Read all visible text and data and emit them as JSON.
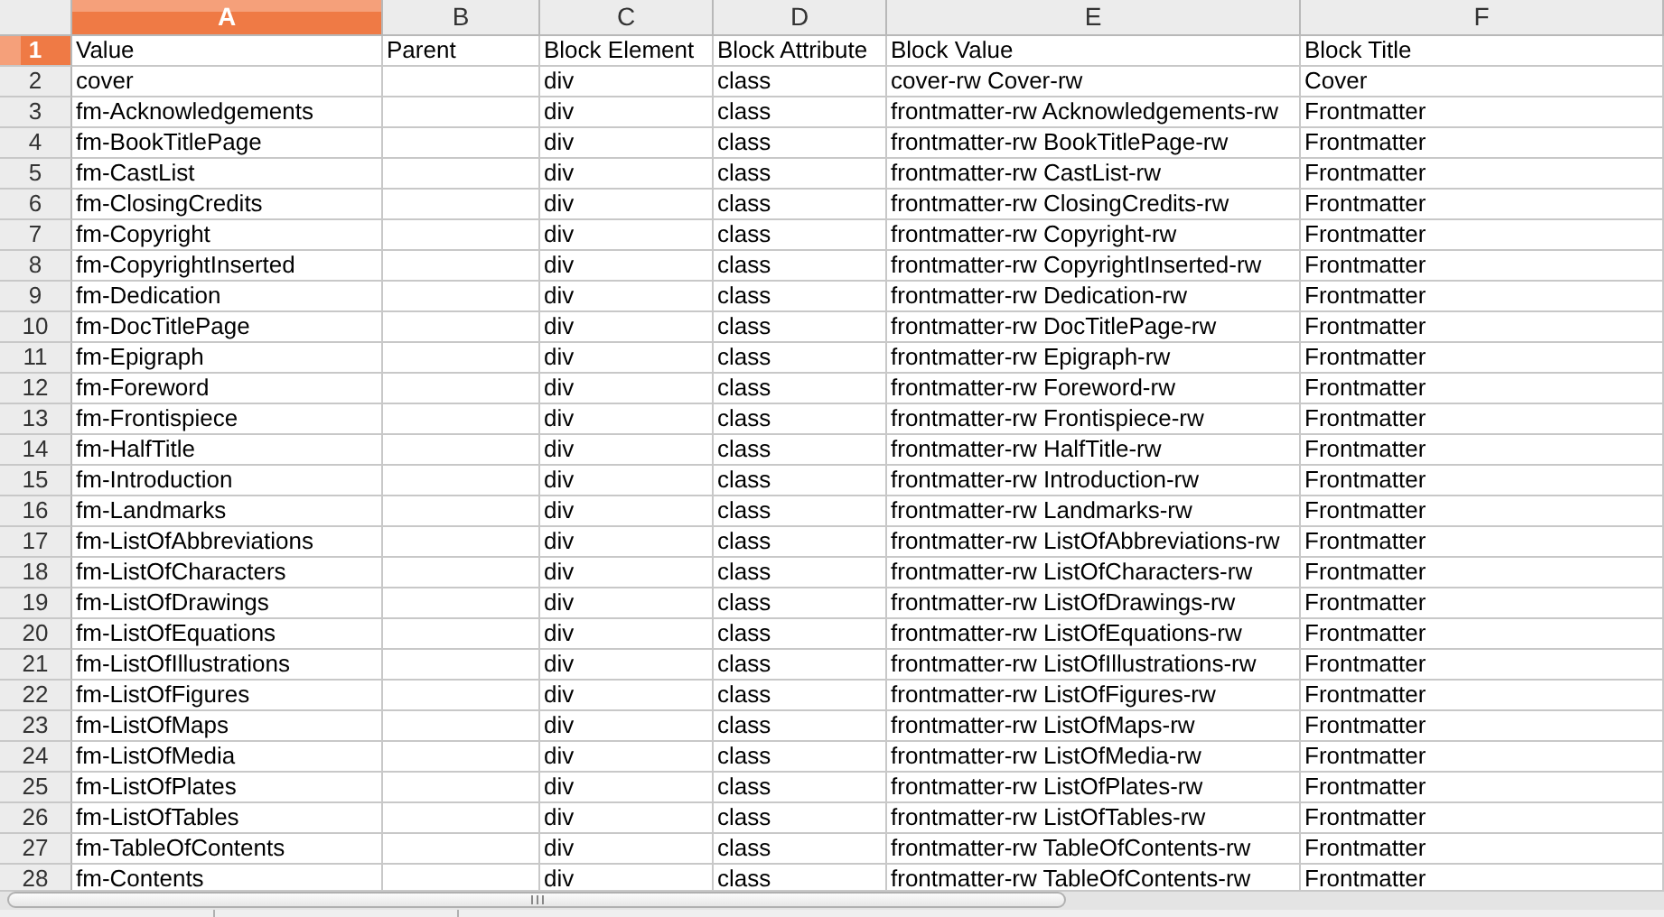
{
  "columns": [
    {
      "label": "A",
      "selected": true
    },
    {
      "label": "B",
      "selected": false
    },
    {
      "label": "C",
      "selected": false
    },
    {
      "label": "D",
      "selected": false
    },
    {
      "label": "E",
      "selected": false
    },
    {
      "label": "F",
      "selected": false
    }
  ],
  "rows": [
    {
      "number": "1",
      "selected": true,
      "cells": {
        "A": "Value",
        "B": "Parent",
        "C": "Block Element",
        "D": "Block Attribute",
        "E": "Block Value",
        "F": "Block Title"
      }
    },
    {
      "number": "2",
      "selected": false,
      "cells": {
        "A": "cover",
        "C": "div",
        "D": "class",
        "E": "cover-rw Cover-rw",
        "F": "Cover"
      }
    },
    {
      "number": "3",
      "selected": false,
      "cells": {
        "A": "fm-Acknowledgements",
        "C": "div",
        "D": "class",
        "E": "frontmatter-rw Acknowledgements-rw",
        "F": "Frontmatter"
      }
    },
    {
      "number": "4",
      "selected": false,
      "cells": {
        "A": "fm-BookTitlePage",
        "C": "div",
        "D": "class",
        "E": "frontmatter-rw BookTitlePage-rw",
        "F": "Frontmatter"
      }
    },
    {
      "number": "5",
      "selected": false,
      "cells": {
        "A": "fm-CastList",
        "C": "div",
        "D": "class",
        "E": "frontmatter-rw CastList-rw",
        "F": "Frontmatter"
      }
    },
    {
      "number": "6",
      "selected": false,
      "cells": {
        "A": "fm-ClosingCredits",
        "C": "div",
        "D": "class",
        "E": "frontmatter-rw ClosingCredits-rw",
        "F": "Frontmatter"
      }
    },
    {
      "number": "7",
      "selected": false,
      "cells": {
        "A": "fm-Copyright",
        "C": "div",
        "D": "class",
        "E": "frontmatter-rw Copyright-rw",
        "F": "Frontmatter"
      }
    },
    {
      "number": "8",
      "selected": false,
      "cells": {
        "A": "fm-CopyrightInserted",
        "C": "div",
        "D": "class",
        "E": "frontmatter-rw CopyrightInserted-rw",
        "F": "Frontmatter"
      }
    },
    {
      "number": "9",
      "selected": false,
      "cells": {
        "A": "fm-Dedication",
        "C": "div",
        "D": "class",
        "E": "frontmatter-rw Dedication-rw",
        "F": "Frontmatter"
      }
    },
    {
      "number": "10",
      "selected": false,
      "cells": {
        "A": "fm-DocTitlePage",
        "C": "div",
        "D": "class",
        "E": "frontmatter-rw DocTitlePage-rw",
        "F": "Frontmatter"
      }
    },
    {
      "number": "11",
      "selected": false,
      "cells": {
        "A": "fm-Epigraph",
        "C": "div",
        "D": "class",
        "E": "frontmatter-rw Epigraph-rw",
        "F": "Frontmatter"
      }
    },
    {
      "number": "12",
      "selected": false,
      "cells": {
        "A": "fm-Foreword",
        "C": "div",
        "D": "class",
        "E": "frontmatter-rw Foreword-rw",
        "F": "Frontmatter"
      }
    },
    {
      "number": "13",
      "selected": false,
      "cells": {
        "A": "fm-Frontispiece",
        "C": "div",
        "D": "class",
        "E": "frontmatter-rw Frontispiece-rw",
        "F": "Frontmatter"
      }
    },
    {
      "number": "14",
      "selected": false,
      "cells": {
        "A": "fm-HalfTitle",
        "C": "div",
        "D": "class",
        "E": "frontmatter-rw HalfTitle-rw",
        "F": "Frontmatter"
      }
    },
    {
      "number": "15",
      "selected": false,
      "cells": {
        "A": "fm-Introduction",
        "C": "div",
        "D": "class",
        "E": "frontmatter-rw Introduction-rw",
        "F": "Frontmatter"
      }
    },
    {
      "number": "16",
      "selected": false,
      "cells": {
        "A": "fm-Landmarks",
        "C": "div",
        "D": "class",
        "E": "frontmatter-rw Landmarks-rw",
        "F": "Frontmatter"
      }
    },
    {
      "number": "17",
      "selected": false,
      "cells": {
        "A": "fm-ListOfAbbreviations",
        "C": "div",
        "D": "class",
        "E": "frontmatter-rw ListOfAbbreviations-rw",
        "F": "Frontmatter"
      }
    },
    {
      "number": "18",
      "selected": false,
      "cells": {
        "A": "fm-ListOfCharacters",
        "C": "div",
        "D": "class",
        "E": "frontmatter-rw ListOfCharacters-rw",
        "F": "Frontmatter"
      }
    },
    {
      "number": "19",
      "selected": false,
      "cells": {
        "A": "fm-ListOfDrawings",
        "C": "div",
        "D": "class",
        "E": "frontmatter-rw ListOfDrawings-rw",
        "F": "Frontmatter"
      }
    },
    {
      "number": "20",
      "selected": false,
      "cells": {
        "A": "fm-ListOfEquations",
        "C": "div",
        "D": "class",
        "E": "frontmatter-rw ListOfEquations-rw",
        "F": "Frontmatter"
      }
    },
    {
      "number": "21",
      "selected": false,
      "cells": {
        "A": "fm-ListOfIllustrations",
        "C": "div",
        "D": "class",
        "E": "frontmatter-rw ListOfIllustrations-rw",
        "F": "Frontmatter"
      }
    },
    {
      "number": "22",
      "selected": false,
      "cells": {
        "A": "fm-ListOfFigures",
        "C": "div",
        "D": "class",
        "E": "frontmatter-rw ListOfFigures-rw",
        "F": "Frontmatter"
      }
    },
    {
      "number": "23",
      "selected": false,
      "cells": {
        "A": "fm-ListOfMaps",
        "C": "div",
        "D": "class",
        "E": "frontmatter-rw ListOfMaps-rw",
        "F": "Frontmatter"
      }
    },
    {
      "number": "24",
      "selected": false,
      "cells": {
        "A": "fm-ListOfMedia",
        "C": "div",
        "D": "class",
        "E": "frontmatter-rw ListOfMedia-rw",
        "F": "Frontmatter"
      }
    },
    {
      "number": "25",
      "selected": false,
      "cells": {
        "A": "fm-ListOfPlates",
        "C": "div",
        "D": "class",
        "E": "frontmatter-rw ListOfPlates-rw",
        "F": "Frontmatter"
      }
    },
    {
      "number": "26",
      "selected": false,
      "cells": {
        "A": "fm-ListOfTables",
        "C": "div",
        "D": "class",
        "E": "frontmatter-rw ListOfTables-rw",
        "F": "Frontmatter"
      }
    },
    {
      "number": "27",
      "selected": false,
      "cells": {
        "A": "fm-TableOfContents",
        "C": "div",
        "D": "class",
        "E": "frontmatter-rw TableOfContents-rw",
        "F": "Frontmatter"
      }
    },
    {
      "number": "28",
      "selected": false,
      "cells": {
        "A": "fm-Contents",
        "C": "div",
        "D": "class",
        "E": "frontmatter-rw TableOfContents-rw",
        "F": "Frontmatter"
      }
    }
  ]
}
